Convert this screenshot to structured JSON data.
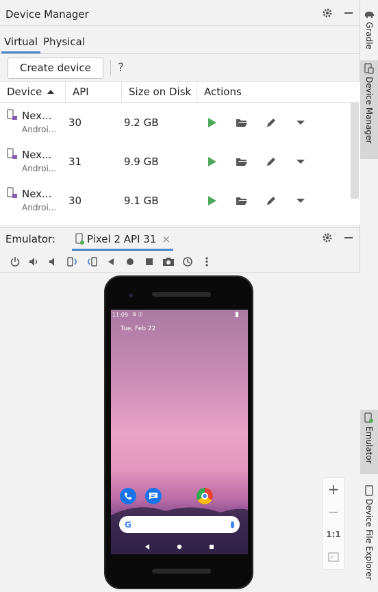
{
  "device_manager": {
    "title": "Device Manager",
    "tabs": [
      {
        "label": "Virtual"
      },
      {
        "label": "Physical"
      }
    ],
    "create_button": "Create device",
    "help": "?",
    "columns": {
      "device": "Device",
      "api": "API",
      "size": "Size on Disk",
      "actions": "Actions"
    },
    "rows": [
      {
        "name": "Nex...",
        "sub": "Androi...",
        "api": "30",
        "size": "9.2 GB"
      },
      {
        "name": "Nex...",
        "sub": "Androi...",
        "api": "31",
        "size": "9.9 GB"
      },
      {
        "name": "Nex...",
        "sub": "Androi...",
        "api": "30",
        "size": "9.1 GB"
      }
    ]
  },
  "emulator": {
    "label": "Emulator:",
    "tab": "Pixel 2 API 31",
    "close": "×",
    "screen": {
      "status_time": "11:09",
      "date": "Tue, Feb 22"
    },
    "zoom": {
      "plus": "+",
      "minus": "−",
      "one_to_one": "1:1"
    }
  },
  "right_strip": {
    "gradle": "Gradle",
    "device_manager": "Device Manager",
    "emulator": "Emulator",
    "device_file_explorer": "Device File Explorer"
  },
  "colors": {
    "accent": "#4a86c8",
    "play": "#4fa85b",
    "android": "#8a5bb0"
  }
}
